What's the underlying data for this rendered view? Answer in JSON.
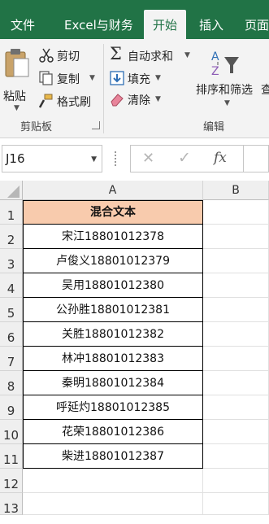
{
  "ribbon_tabs": [
    {
      "label": "文件"
    },
    {
      "label": "Excel与财务"
    },
    {
      "label": "开始"
    },
    {
      "label": "插入"
    },
    {
      "label": "页面"
    }
  ],
  "clipboard": {
    "paste": "粘贴",
    "cut": "剪切",
    "copy": "复制",
    "format_painter": "格式刷",
    "group_label": "剪贴板"
  },
  "editing": {
    "autosum": "自动求和",
    "fill": "填充",
    "clear": "清除",
    "sort_filter": "排序和筛选",
    "find_partial": "查",
    "group_label": "编辑"
  },
  "formula_bar": {
    "name_box": "J16",
    "cancel": "✕",
    "enter": "✓",
    "fx": "fx"
  },
  "sheet": {
    "columns": [
      "A",
      "B"
    ],
    "rows": [
      "1",
      "2",
      "3",
      "4",
      "5",
      "6",
      "7",
      "8",
      "9",
      "10",
      "11",
      "12",
      "13"
    ],
    "header": "混合文本",
    "values": [
      "宋江18801012378",
      "卢俊义18801012379",
      "吴用18801012380",
      "公孙胜18801012381",
      "关胜18801012382",
      "林冲18801012383",
      "秦明18801012384",
      "呼延灼18801012385",
      "花荣18801012386",
      "柴进18801012387"
    ]
  },
  "colors": {
    "ribbon_green": "#217346",
    "header_fill": "#f8cbad"
  }
}
